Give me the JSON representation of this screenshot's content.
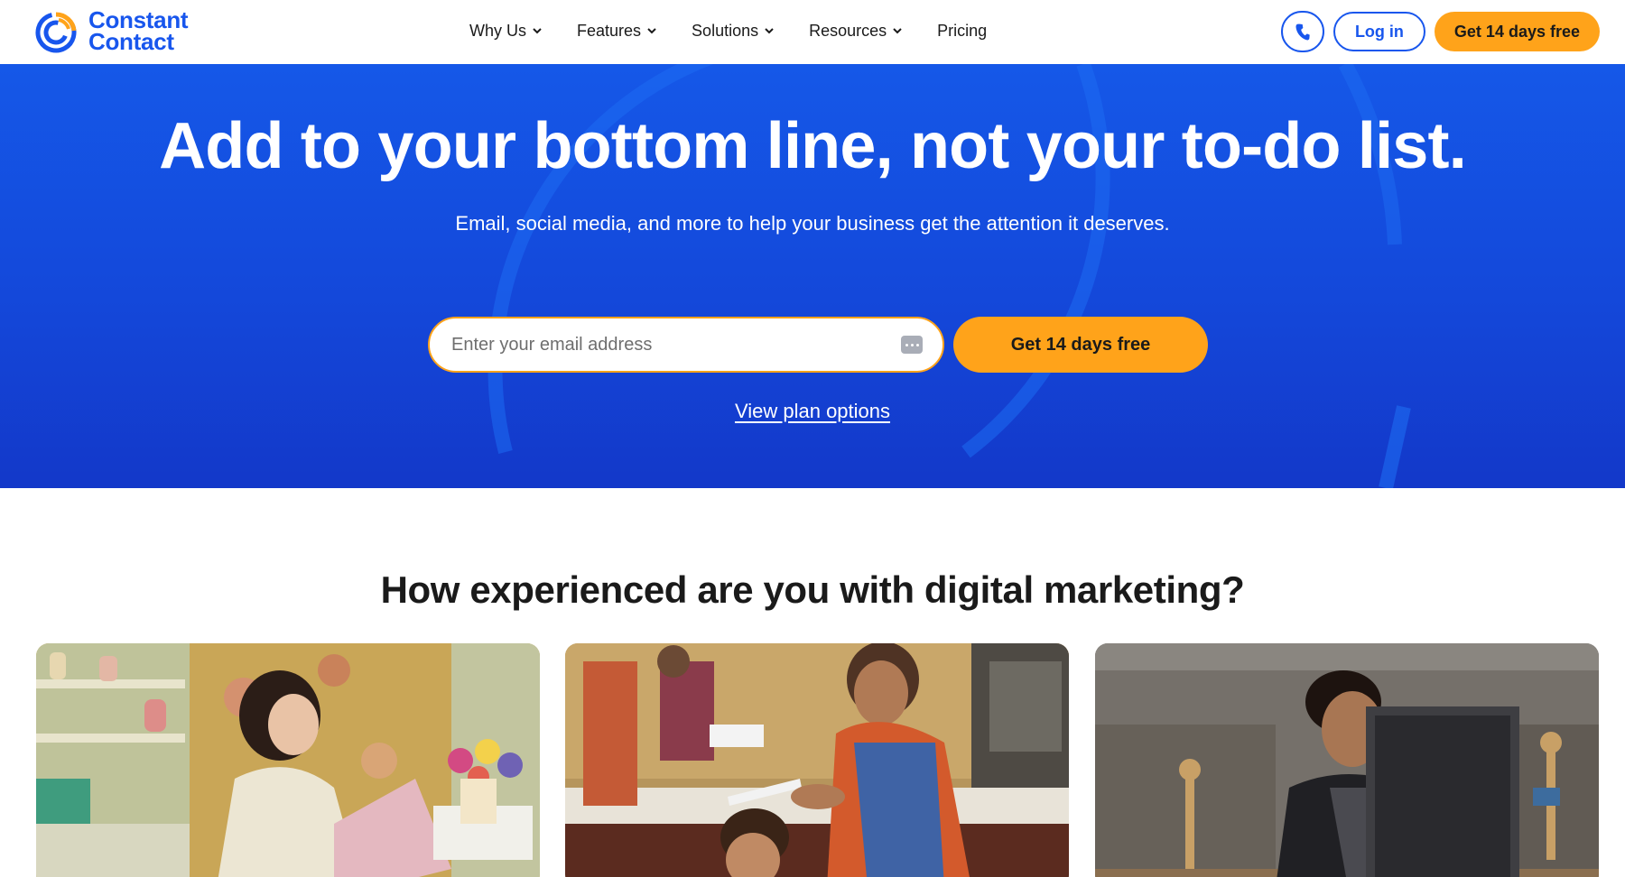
{
  "brand": {
    "name_line1": "Constant",
    "name_line2": "Contact",
    "primary": "#1856ED",
    "accent": "#FFA31A"
  },
  "nav": {
    "items": [
      {
        "label": "Why Us",
        "has_menu": true
      },
      {
        "label": "Features",
        "has_menu": true
      },
      {
        "label": "Solutions",
        "has_menu": true
      },
      {
        "label": "Resources",
        "has_menu": true
      },
      {
        "label": "Pricing",
        "has_menu": false
      }
    ]
  },
  "header": {
    "phone_icon": "phone-icon",
    "login_label": "Log in",
    "cta_label": "Get 14 days free"
  },
  "hero": {
    "title": "Add to your bottom line, not your to-do list.",
    "subtitle": "Email, social media, and more to help your business get the attention it deserves.",
    "email_placeholder": "Enter your email address",
    "cta_label": "Get 14 days free",
    "plan_link": "View plan options"
  },
  "section": {
    "title": "How experienced are you with digital marketing?",
    "cards": [
      {
        "image": "woman-florist-laptop-photo"
      },
      {
        "image": "barber-cutting-hair-photo"
      },
      {
        "image": "woman-at-computer-photo"
      }
    ]
  }
}
